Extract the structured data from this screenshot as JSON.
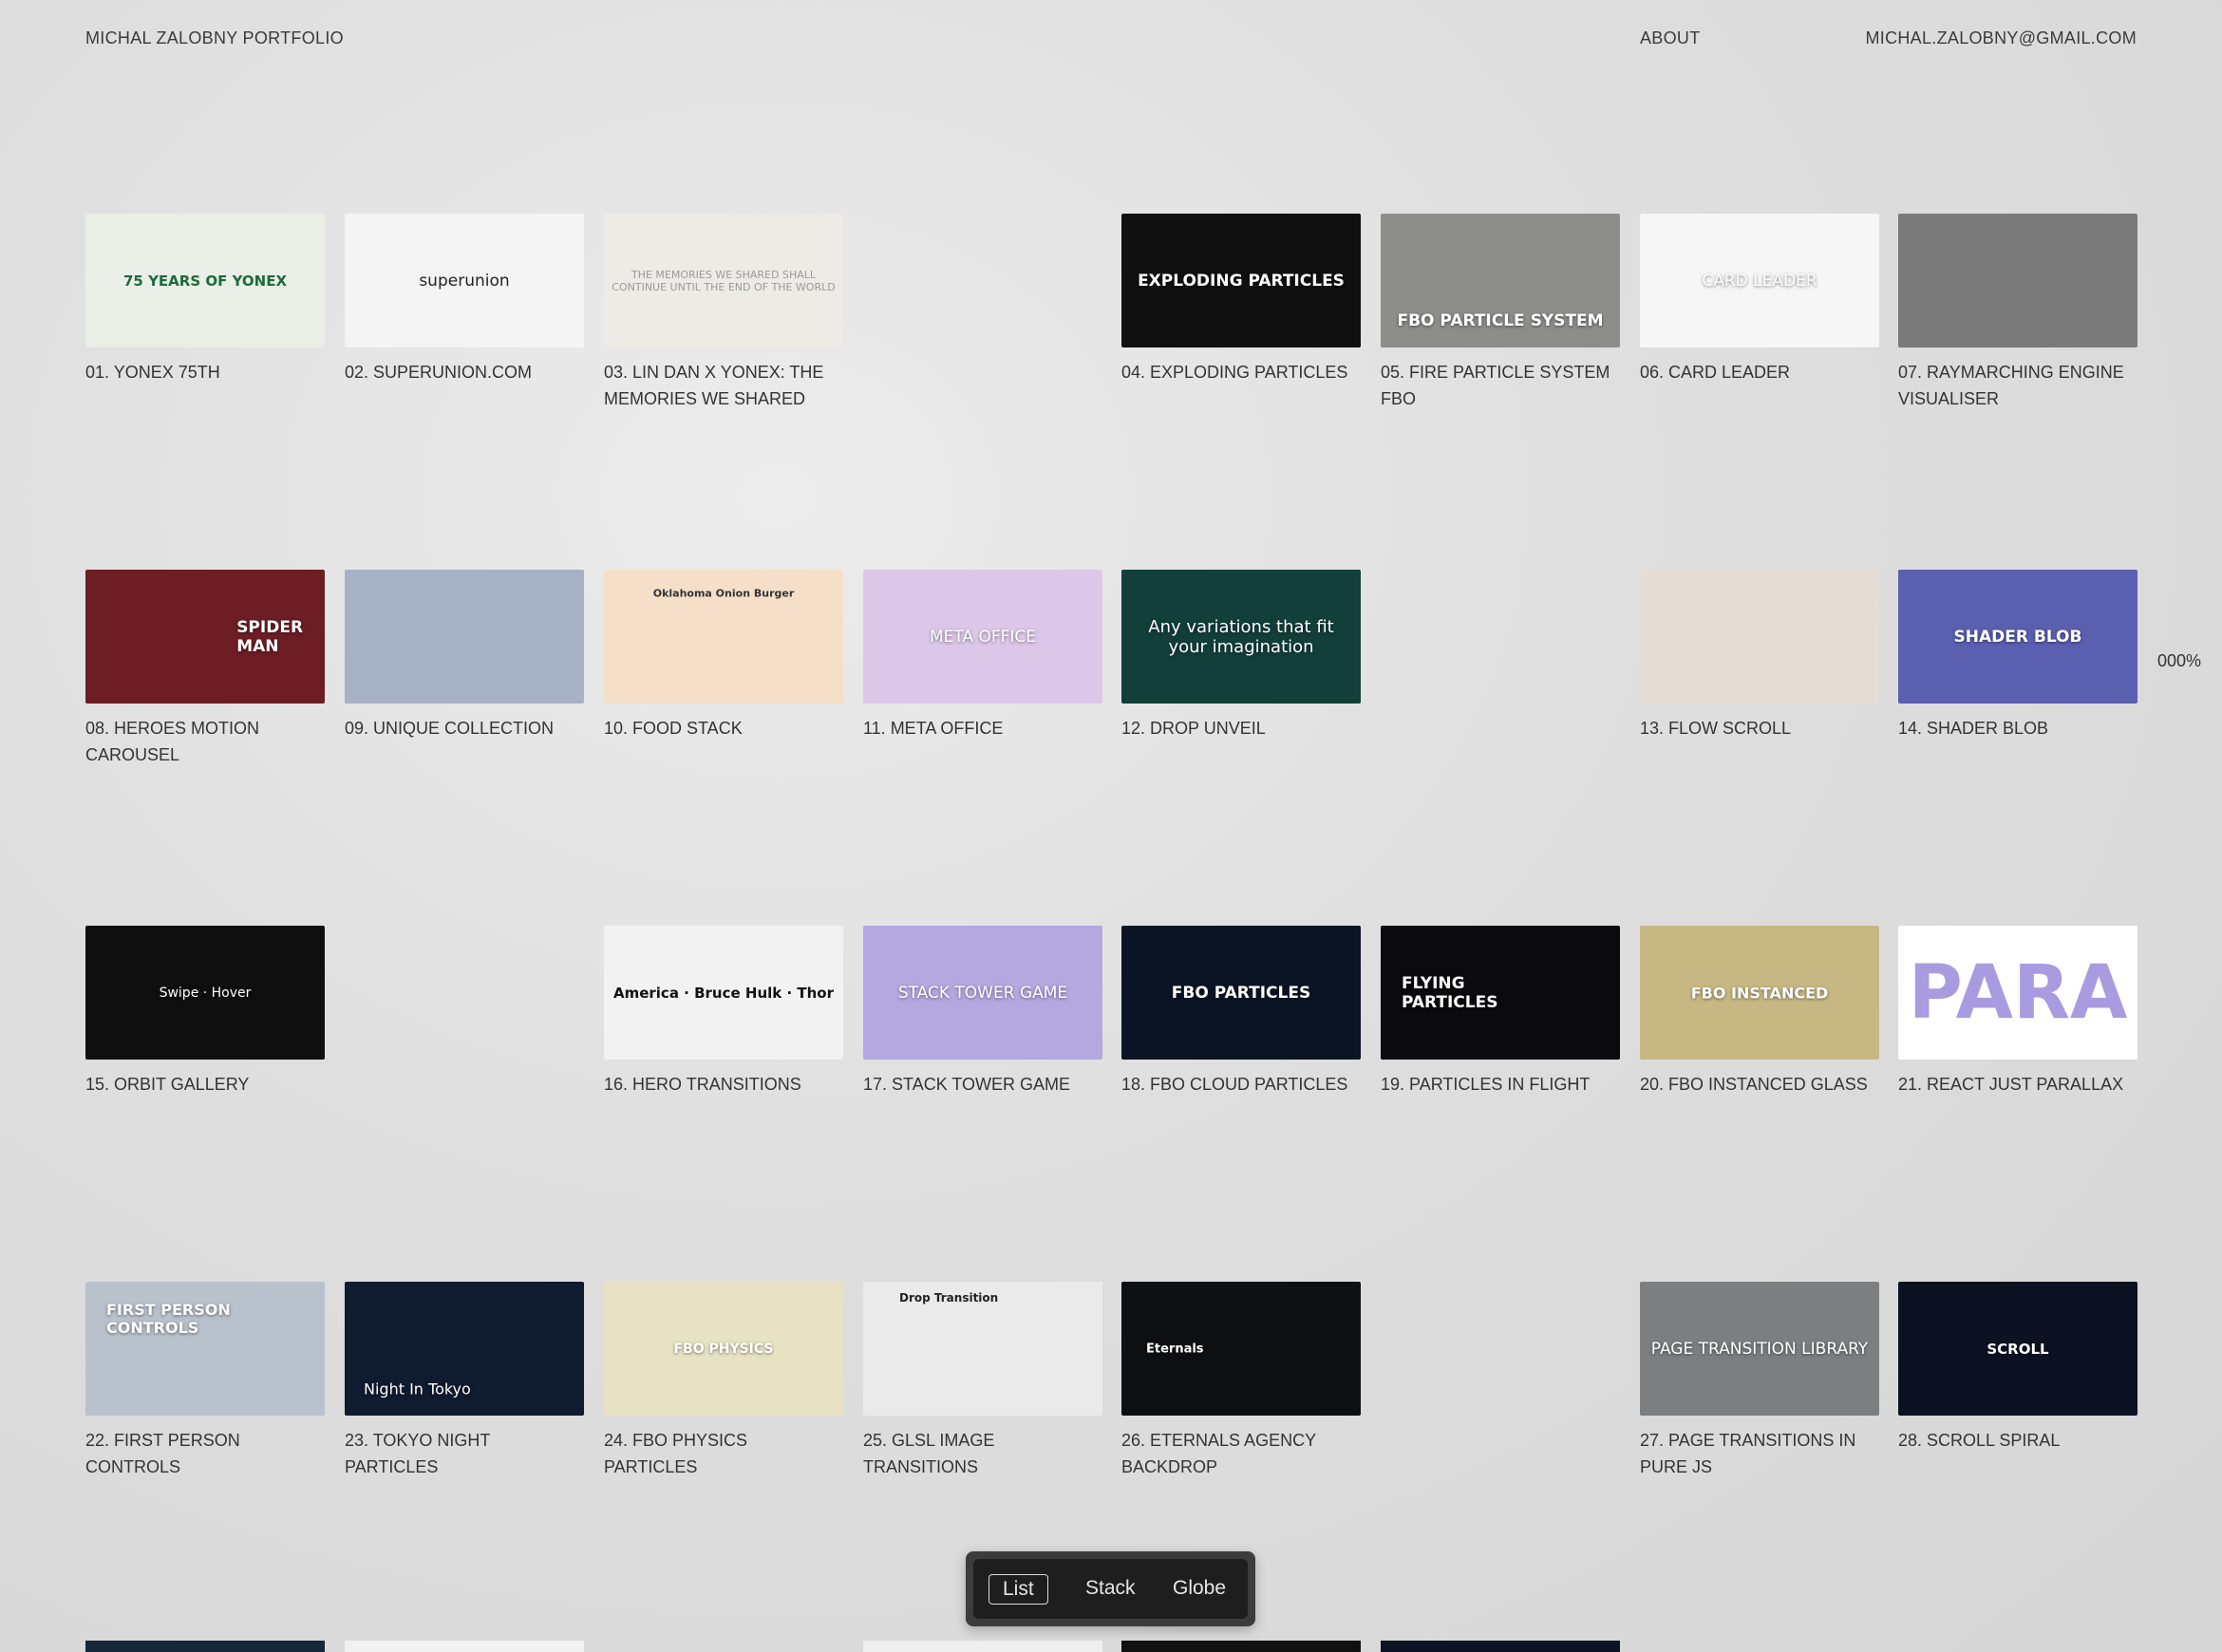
{
  "header": {
    "brand": "MICHAL ZALOBNY PORTFOLIO",
    "about": "ABOUT",
    "email": "MICHAL.ZALOBNY@GMAIL.COM"
  },
  "side_indicator": "000%",
  "projects": [
    {
      "caption": "01. YONEX 75TH",
      "thumb_text": "75 YEARS OF YONEX",
      "bg": "#e9eee6"
    },
    {
      "caption": "02. SUPERUNION.COM",
      "thumb_text": "superunion",
      "bg": "#f4f4f4"
    },
    {
      "caption": "03. LIN DAN X YONEX: THE MEMORIES WE SHARED",
      "thumb_text": "THE MEMORIES WE SHARED SHALL CONTINUE UNTIL THE END OF THE WORLD",
      "bg": "#ecebe6"
    },
    {
      "caption": "04. EXPLODING PARTICLES",
      "thumb_text": "EXPLODING PARTICLES",
      "bg": "#101010"
    },
    {
      "caption": "05. FIRE PARTICLE SYSTEM FBO",
      "thumb_text": "FBO PARTICLE SYSTEM",
      "bg": "#8d8d8a"
    },
    {
      "caption": "06. CARD LEADER",
      "thumb_text": "CARD LEADER",
      "bg": "#f6f6f6"
    },
    {
      "caption": "07. RAYMARCHING ENGINE VISUALISER",
      "thumb_text": "",
      "bg": "#7a7a7a"
    },
    {
      "caption": "08. HEROES MOTION CAROUSEL",
      "thumb_text": "SPIDER MAN",
      "bg": "#6d1d24"
    },
    {
      "caption": "09. UNIQUE COLLECTION",
      "thumb_text": "",
      "bg": "#a6b1c6"
    },
    {
      "caption": "10. FOOD STACK",
      "thumb_text": "Oklahoma Onion Burger",
      "bg": "#f5dfc9"
    },
    {
      "caption": "11. META OFFICE",
      "thumb_text": "META OFFICE",
      "bg": "#ddc7e9"
    },
    {
      "caption": "12. DROP UNVEIL",
      "thumb_text": "Any variations that fit your imagination",
      "bg": "#123f3a"
    },
    {
      "caption": "13. FLOW SCROLL",
      "thumb_text": "",
      "bg": "#e3ddd4"
    },
    {
      "caption": "14. SHADER BLOB",
      "thumb_text": "SHADER BLOB",
      "bg": "#5a5fb0"
    },
    {
      "caption": "15. ORBIT GALLERY",
      "thumb_text": "Swipe · Hover",
      "bg": "#0f0f0f"
    },
    {
      "caption": "16. HERO TRANSITIONS",
      "thumb_text": "America · Bruce Hulk · Thor",
      "bg": "#f2f2f2"
    },
    {
      "caption": "17. STACK TOWER GAME",
      "thumb_text": "STACK TOWER GAME",
      "bg": "#b3a8e0"
    },
    {
      "caption": "18. FBO CLOUD PARTICLES",
      "thumb_text": "FBO PARTICLES",
      "bg": "#0b1424"
    },
    {
      "caption": "19. PARTICLES IN FLIGHT",
      "thumb_text": "FLYING PARTICLES",
      "bg": "#0a0a0f"
    },
    {
      "caption": "20. FBO INSTANCED GLASS",
      "thumb_text": "FBO INSTANCED",
      "bg": "#c7b883"
    },
    {
      "caption": "21. REACT JUST PARALLAX",
      "thumb_text": "PARA",
      "bg": "#ffffff"
    },
    {
      "caption": "22. FIRST PERSON CONTROLS",
      "thumb_text": "FIRST PERSON CONTROLS",
      "bg": "#b8c1cc"
    },
    {
      "caption": "23. TOKYO NIGHT PARTICLES",
      "thumb_text": "Night In Tokyo",
      "bg": "#0f1b2e"
    },
    {
      "caption": "24. FBO PHYSICS PARTICLES",
      "thumb_text": "FBO PHYSICS",
      "bg": "#e8e2c4"
    },
    {
      "caption": "25. GLSL IMAGE TRANSITIONS",
      "thumb_text": "Drop Transition",
      "bg": "#eaeaea"
    },
    {
      "caption": "26. ETERNALS AGENCY BACKDROP",
      "thumb_text": "Eternals",
      "bg": "#0e0f10"
    },
    {
      "caption": "27. PAGE TRANSITIONS IN PURE JS",
      "thumb_text": "PAGE TRANSITION LIBRARY",
      "bg": "#7b7f82"
    },
    {
      "caption": "28. SCROLL SPIRAL",
      "thumb_text": "SCROLL",
      "bg": "#0c1222"
    }
  ],
  "bottom_row_colors": [
    "#16283a",
    "#f1f1f1",
    "",
    "#eeeeee",
    "#111111",
    "#0e1424"
  ],
  "view_switcher": {
    "options": [
      "List",
      "Stack",
      "Globe"
    ],
    "active": "List"
  }
}
